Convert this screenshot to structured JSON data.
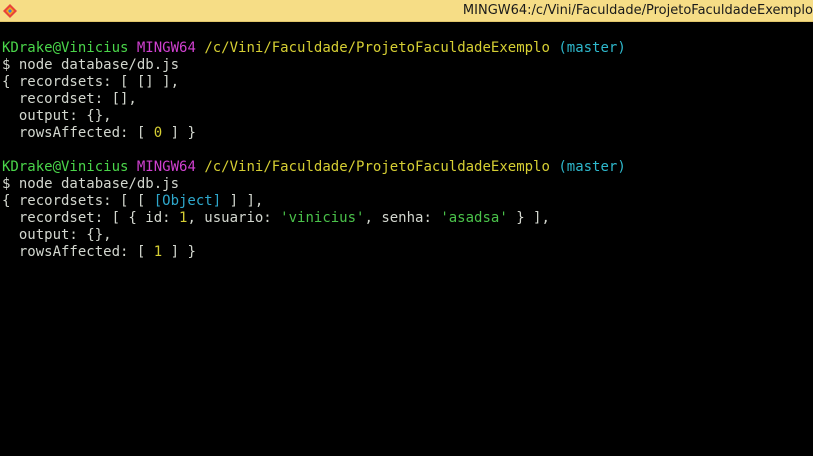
{
  "window": {
    "title": "MINGW64:/c/Vini/Faculdade/ProjetoFaculdadeExemplo",
    "icon": "git-bash-icon"
  },
  "colors": {
    "titlebar": "#F6DD86",
    "background": "#000000",
    "user_host": "#4AD54A",
    "system": "#D040D0",
    "path": "#D5CE33",
    "branch": "#2EB8CC",
    "text": "#D3D7CF"
  },
  "blocks": [
    {
      "prompt": {
        "user_host": "KDrake@Vinicius",
        "system": "MINGW64",
        "path": "/c/Vini/Faculdade/ProjetoFaculdadeExemplo",
        "branch": "(master)"
      },
      "command": "$ node database/db.js",
      "output": {
        "l1_open": "{ recordsets: [ [] ],",
        "l2": "  recordset: [],",
        "l3": "  output: {},",
        "l4_a": "  rowsAffected: [ ",
        "l4_num": "0",
        "l4_b": " ] }"
      }
    },
    {
      "prompt": {
        "user_host": "KDrake@Vinicius",
        "system": "MINGW64",
        "path": "/c/Vini/Faculdade/ProjetoFaculdadeExemplo",
        "branch": "(master)"
      },
      "command": "$ node database/db.js",
      "output": {
        "l1_a": "{ recordsets: [ [ ",
        "l1_obj": "[Object]",
        "l1_b": " ] ],",
        "l2_a": "  recordset: [ { id: ",
        "l2_id": "1",
        "l2_b": ", usuario: ",
        "l2_user": "'vinicius'",
        "l2_c": ", senha: ",
        "l2_pass": "'asadsa'",
        "l2_d": " } ],",
        "l3": "  output: {},",
        "l4_a": "  rowsAffected: [ ",
        "l4_num": "1",
        "l4_b": " ] }"
      }
    }
  ]
}
